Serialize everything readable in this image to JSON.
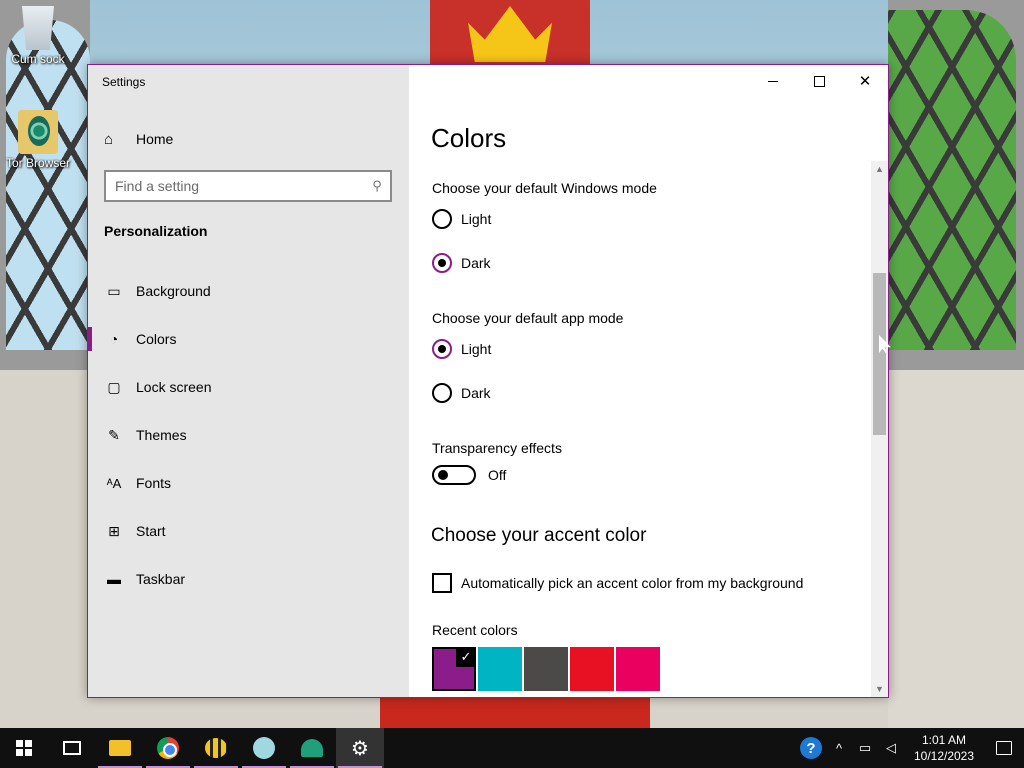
{
  "desktop": {
    "icons": [
      {
        "label": "Cum sock"
      },
      {
        "label": "Tor Browser"
      }
    ]
  },
  "window": {
    "title": "Settings",
    "sidebar": {
      "home_label": "Home",
      "search_placeholder": "Find a setting",
      "section_title": "Personalization",
      "items": [
        {
          "label": "Background",
          "icon": "image-icon"
        },
        {
          "label": "Colors",
          "icon": "palette-icon",
          "active": true
        },
        {
          "label": "Lock screen",
          "icon": "lock-screen-icon"
        },
        {
          "label": "Themes",
          "icon": "themes-brush-icon"
        },
        {
          "label": "Fonts",
          "icon": "fonts-icon"
        },
        {
          "label": "Start",
          "icon": "start-grid-icon"
        },
        {
          "label": "Taskbar",
          "icon": "taskbar-icon"
        }
      ]
    },
    "content": {
      "page_title": "Colors",
      "windows_mode": {
        "label": "Choose your default Windows mode",
        "options": [
          "Light",
          "Dark"
        ],
        "selected": "Dark"
      },
      "app_mode": {
        "label": "Choose your default app mode",
        "options": [
          "Light",
          "Dark"
        ],
        "selected": "Light"
      },
      "transparency": {
        "label": "Transparency effects",
        "state": "Off"
      },
      "accent": {
        "title": "Choose your accent color",
        "auto_pick_label": "Automatically pick an accent color from my background",
        "auto_pick_checked": false,
        "recent_label": "Recent colors",
        "recent_colors": [
          "#8b1d8b",
          "#00b4c4",
          "#4c4a48",
          "#e81123",
          "#ea005e"
        ],
        "selected_color": "#8b1d8b"
      }
    }
  },
  "taskbar": {
    "apps": [
      "start-icon",
      "task-view-icon",
      "file-explorer-icon",
      "chrome-icon",
      "bee-app-icon",
      "anime-app-icon",
      "dome-app-icon",
      "settings-gear-icon"
    ],
    "clock": {
      "time": "1:01 AM",
      "date": "10/12/2023"
    }
  }
}
